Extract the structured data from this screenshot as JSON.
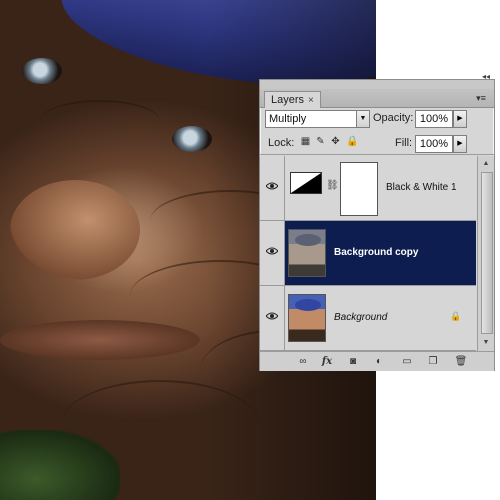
{
  "panel": {
    "tab_label": "Layers",
    "tab_close": "×",
    "blend_mode": "Multiply",
    "opacity_label": "Opacity:",
    "opacity_value": "100%",
    "lock_label": "Lock:",
    "fill_label": "Fill:",
    "fill_value": "100%"
  },
  "layers": [
    {
      "name": "Black & White 1",
      "type": "adjustment",
      "visible": true,
      "selected": false
    },
    {
      "name": "Background copy",
      "type": "image",
      "visible": true,
      "selected": true
    },
    {
      "name": "Background",
      "type": "image",
      "visible": true,
      "selected": false,
      "locked": true
    }
  ],
  "icons": {
    "lock_transparent": "transparency-lock-icon",
    "lock_image": "brush-lock-icon",
    "lock_position": "move-lock-icon",
    "lock_all": "padlock-icon",
    "footer": [
      "link-layers-icon",
      "fx-icon",
      "add-mask-icon",
      "adjustment-layer-icon",
      "new-group-icon",
      "new-layer-icon",
      "trash-icon"
    ]
  },
  "colors": {
    "selected_row": "#0e1d4f",
    "panel_bg": "#d6d6d6"
  }
}
